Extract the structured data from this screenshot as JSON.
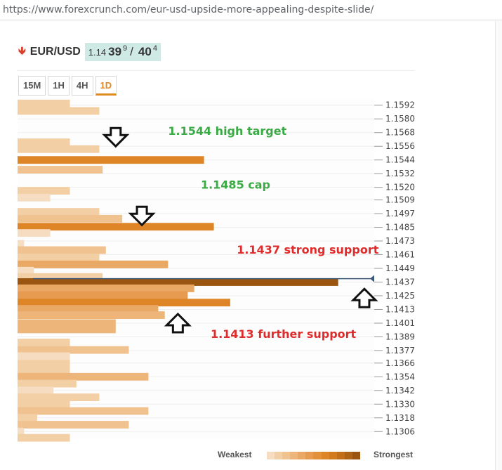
{
  "browser": {
    "url": "https://www.forexcrunch.com/eur-usd-upside-more-appealing-despite-slide/"
  },
  "ticker": {
    "pair": "EUR/USD",
    "direction": "down",
    "quote_prefix": "1.14",
    "bid_big": "39",
    "bid_sup": "9",
    "separator": "/",
    "ask_big": "40",
    "ask_sup": "4"
  },
  "tabs": [
    {
      "label": "15M",
      "active": false
    },
    {
      "label": "1H",
      "active": false
    },
    {
      "label": "4H",
      "active": false
    },
    {
      "label": "1D",
      "active": true
    }
  ],
  "legend": {
    "weakest": "Weakest",
    "strongest": "Strongest",
    "colors": [
      "#f6dcc0",
      "#f3cfa6",
      "#f0c290",
      "#edb57a",
      "#eaa865",
      "#e79b50",
      "#e3903a",
      "#de8627",
      "#d27a1e",
      "#c26e18",
      "#ad6214",
      "#9a5610"
    ]
  },
  "colors": {
    "green_annotation": "#3aaa45",
    "red_annotation": "#e02b2b",
    "price_line": "#3e5a78"
  },
  "chart_data": {
    "type": "bar",
    "orientation": "horizontal",
    "price_ticks": [
      "1.1592",
      "1.1580",
      "1.1568",
      "1.1556",
      "1.1544",
      "1.1532",
      "1.1520",
      "1.1509",
      "1.1497",
      "1.1485",
      "1.1473",
      "1.1461",
      "1.1449",
      "1.1437",
      "1.1425",
      "1.1413",
      "1.1401",
      "1.1389",
      "1.1377",
      "1.1366",
      "1.1354",
      "1.1342",
      "1.1330",
      "1.1318",
      "1.1306"
    ],
    "price_range": [
      1.13,
      1.1598
    ],
    "current_price": 1.144,
    "strength_scale": [
      0,
      10
    ],
    "levels": [
      {
        "price": 1.15935,
        "strength": 1.6,
        "shade": 1
      },
      {
        "price": 1.1587,
        "strength": 2.5,
        "shade": 1
      },
      {
        "price": 1.15595,
        "strength": 1.6,
        "shade": 1
      },
      {
        "price": 1.15535,
        "strength": 2.5,
        "shade": 1
      },
      {
        "price": 1.1544,
        "strength": 5.7,
        "shade": 7
      },
      {
        "price": 1.15355,
        "strength": 2.6,
        "shade": 2
      },
      {
        "price": 1.1517,
        "strength": 1.6,
        "shade": 1
      },
      {
        "price": 1.1511,
        "strength": 1.0,
        "shade": 0
      },
      {
        "price": 1.14985,
        "strength": 2.5,
        "shade": 1
      },
      {
        "price": 1.14925,
        "strength": 3.2,
        "shade": 2
      },
      {
        "price": 1.14855,
        "strength": 6.0,
        "shade": 7
      },
      {
        "price": 1.148,
        "strength": 1.0,
        "shade": 0
      },
      {
        "price": 1.14705,
        "strength": 0.2,
        "shade": 0
      },
      {
        "price": 1.1465,
        "strength": 2.7,
        "shade": 2
      },
      {
        "price": 1.14585,
        "strength": 2.5,
        "shade": 1
      },
      {
        "price": 1.14525,
        "strength": 4.6,
        "shade": 4
      },
      {
        "price": 1.1447,
        "strength": 0.5,
        "shade": 0
      },
      {
        "price": 1.14415,
        "strength": 2.6,
        "shade": 1
      },
      {
        "price": 1.1437,
        "strength": 9.8,
        "shade": 11
      },
      {
        "price": 1.14315,
        "strength": 5.4,
        "shade": 4
      },
      {
        "price": 1.14255,
        "strength": 5.2,
        "shade": 5
      },
      {
        "price": 1.1419,
        "strength": 6.5,
        "shade": 7
      },
      {
        "price": 1.14135,
        "strength": 4.3,
        "shade": 4
      },
      {
        "price": 1.1408,
        "strength": 4.5,
        "shade": 3
      },
      {
        "price": 1.1401,
        "strength": 3.0,
        "shade": 3
      },
      {
        "price": 1.13955,
        "strength": 3.0,
        "shade": 3
      },
      {
        "price": 1.1384,
        "strength": 1.6,
        "shade": 1
      },
      {
        "price": 1.13775,
        "strength": 3.4,
        "shade": 2
      },
      {
        "price": 1.1372,
        "strength": 1.6,
        "shade": 0
      },
      {
        "price": 1.13655,
        "strength": 1.6,
        "shade": 1
      },
      {
        "price": 1.136,
        "strength": 1.6,
        "shade": 1
      },
      {
        "price": 1.1354,
        "strength": 4.0,
        "shade": 3
      },
      {
        "price": 1.1348,
        "strength": 1.8,
        "shade": 1
      },
      {
        "price": 1.1342,
        "strength": 1.1,
        "shade": 0
      },
      {
        "price": 1.1336,
        "strength": 2.5,
        "shade": 1
      },
      {
        "price": 1.133,
        "strength": 1.6,
        "shade": 1
      },
      {
        "price": 1.1324,
        "strength": 4.0,
        "shade": 2
      },
      {
        "price": 1.1318,
        "strength": 0.6,
        "shade": 1
      },
      {
        "price": 1.1312,
        "strength": 3.4,
        "shade": 2
      },
      {
        "price": 1.1306,
        "strength": 0.2,
        "shade": 0
      },
      {
        "price": 1.13005,
        "strength": 1.6,
        "shade": 1
      }
    ],
    "annotations": [
      {
        "text": "1.1544 high target",
        "color": "green",
        "price": 1.1566,
        "x_strength": 4.6
      },
      {
        "text": "1.1485 cap",
        "color": "green",
        "price": 1.1519,
        "x_strength": 5.6
      },
      {
        "text": "1.1437 strong support",
        "color": "red",
        "price": 1.1462,
        "x_strength": 6.7
      },
      {
        "text": "1.1413 further support",
        "color": "red",
        "price": 1.1388,
        "x_strength": 5.9
      }
    ],
    "arrows": [
      {
        "direction": "down",
        "price": 1.1564,
        "x_strength": 3.0
      },
      {
        "direction": "down",
        "price": 1.1495,
        "x_strength": 3.8
      },
      {
        "direction": "up",
        "price": 1.1423,
        "x_strength": 10.6
      },
      {
        "direction": "up",
        "price": 1.1401,
        "x_strength": 4.9
      }
    ]
  }
}
